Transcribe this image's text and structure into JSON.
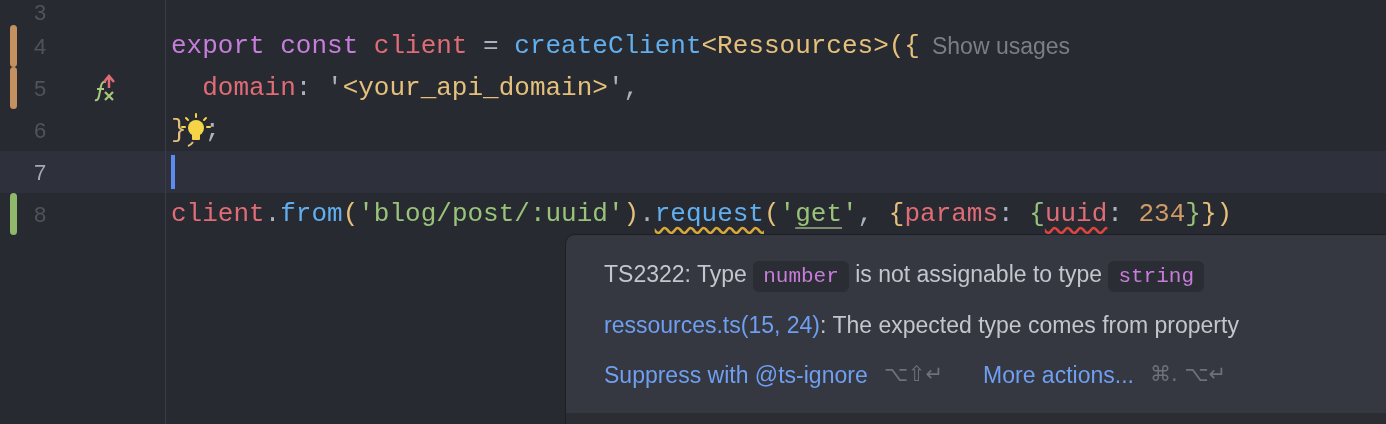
{
  "editor": {
    "lines": [
      {
        "number": "3",
        "current": false
      },
      {
        "number": "4",
        "marker": {
          "color": "#c4905f"
        },
        "current": false,
        "tokens": [
          {
            "kind": "keyword",
            "text": "export const "
          },
          {
            "kind": "variable",
            "text": "client"
          },
          {
            "kind": "plain",
            "text": " = "
          },
          {
            "kind": "function",
            "text": "createClient"
          },
          {
            "kind": "type",
            "text": "<Ressources>({"
          }
        ],
        "hint": "Show usages"
      },
      {
        "number": "5",
        "marker": {
          "color": "#c4905f"
        },
        "current": false,
        "gutter_icon": {
          "kind": "function-override"
        },
        "tokens": [
          {
            "kind": "variable",
            "text": "  domain"
          },
          {
            "kind": "plain",
            "text": ": "
          },
          {
            "kind": "plain",
            "text": "'"
          },
          {
            "kind": "type",
            "text": "<your_api_domain>"
          },
          {
            "kind": "plain",
            "text": "',"
          }
        ]
      },
      {
        "number": "6",
        "current": false,
        "tokens": [
          {
            "kind": "type",
            "text": "}"
          },
          {
            "kind": "bulb"
          },
          {
            "kind": "plain",
            "text": ";"
          }
        ]
      },
      {
        "number": "7",
        "current": true
      },
      {
        "number": "8",
        "marker": {
          "color": "#8fb86b"
        },
        "current": false,
        "tokens": [
          {
            "kind": "variable",
            "text": "client"
          },
          {
            "kind": "plain",
            "text": "."
          },
          {
            "kind": "function",
            "text": "from"
          },
          {
            "kind": "type",
            "text": "("
          },
          {
            "kind": "string",
            "text": "'blog/post/:uuid'"
          },
          {
            "kind": "type",
            "text": ")"
          },
          {
            "kind": "plain",
            "text": "."
          },
          {
            "kind": "function",
            "text": "request",
            "squiggle": {
              "kind": "warning"
            }
          },
          {
            "kind": "type",
            "text": "("
          },
          {
            "kind": "string",
            "text": "'"
          },
          {
            "kind": "string",
            "text": "get",
            "squiggle": {
              "kind": "hint"
            }
          },
          {
            "kind": "string",
            "text": "'"
          },
          {
            "kind": "plain",
            "text": ", "
          },
          {
            "kind": "type",
            "text": "{"
          },
          {
            "kind": "variable",
            "text": "params"
          },
          {
            "kind": "plain",
            "text": ": "
          },
          {
            "kind": "string",
            "text": "{"
          },
          {
            "kind": "variable",
            "text": "uuid",
            "squiggle": {
              "kind": "error"
            }
          },
          {
            "kind": "plain",
            "text": ": "
          },
          {
            "kind": "number",
            "text": "234"
          },
          {
            "kind": "string",
            "text": "}"
          },
          {
            "kind": "type",
            "text": "})"
          }
        ]
      }
    ]
  },
  "popup": {
    "message": [
      {
        "kind": "text",
        "text": "TS2322: Type "
      },
      {
        "kind": "code",
        "text": "number"
      },
      {
        "kind": "text",
        "text": " is not assignable to type "
      },
      {
        "kind": "code",
        "text": "string"
      }
    ],
    "related": {
      "link": "ressources.ts(15, 24)",
      "text": ": The expected type comes from property"
    },
    "actions": [
      {
        "label": "Suppress with @ts-ignore",
        "shortcut": "⌥⇧↵"
      },
      {
        "label": "More actions...",
        "shortcut": "⌘. ⌥↵"
      }
    ]
  }
}
